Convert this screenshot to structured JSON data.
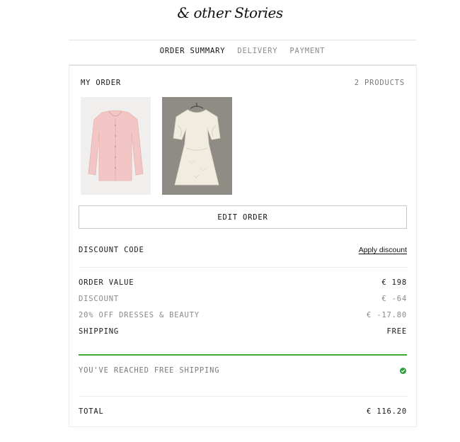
{
  "header": {
    "logo_text": "& other Stories"
  },
  "steps": [
    {
      "label": "ORDER SUMMARY",
      "active": true
    },
    {
      "label": "DELIVERY",
      "active": false
    },
    {
      "label": "PAYMENT",
      "active": false
    }
  ],
  "order": {
    "title": "MY ORDER",
    "count": "2 PRODUCTS",
    "products": [
      {
        "name": "pink-cardigan",
        "color": "#f2c8c6"
      },
      {
        "name": "cream-dress",
        "color": "#f1ece0"
      }
    ],
    "edit_label": "EDIT ORDER"
  },
  "discount": {
    "label": "DISCOUNT CODE",
    "apply_label": "Apply discount"
  },
  "summary": {
    "order_value_label": "ORDER VALUE",
    "order_value": "€ 198",
    "discount_label": "DISCOUNT",
    "discount_value": "€ -64",
    "promo_label": "20% OFF DRESSES & BEAUTY",
    "promo_value": "€ -17.80",
    "shipping_label": "SHIPPING",
    "shipping_value": "FREE"
  },
  "free_shipping": {
    "message": "YOU'VE REACHED FREE SHIPPING",
    "progress_percent": 100,
    "color": "#3aaa35"
  },
  "total": {
    "label": "TOTAL",
    "value": "€ 116.20"
  }
}
